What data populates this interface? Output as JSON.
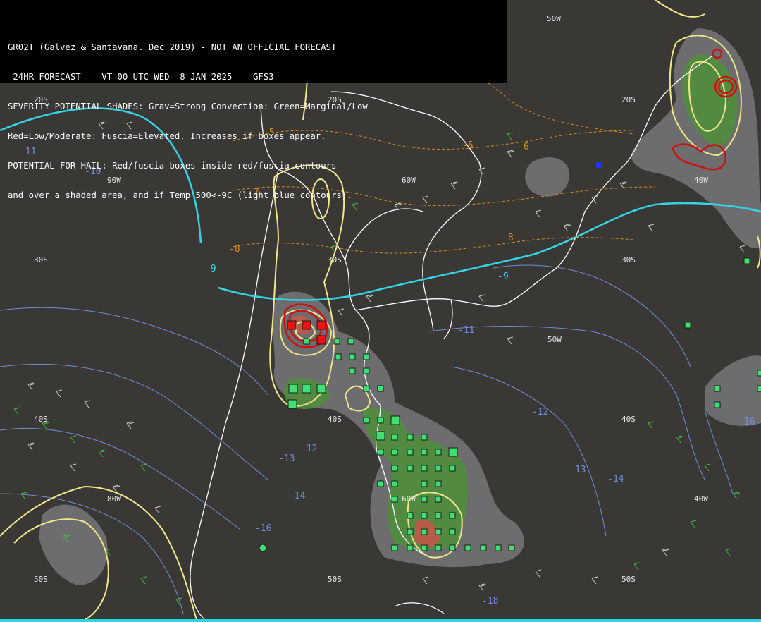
{
  "header": {
    "line1": "GR02T (Galvez & Santavana. Dec 2019) - NOT AN OFFICIAL FORECAST",
    "line2": " 24HR FORECAST    VT 00 UTC WED  8 JAN 2025    GFS3",
    "line3": "SEVERITY POTENTIAL SHADES: Grav=Strong Convection: Green=Marginal/Low",
    "line4": "Red=Low/Moderate: Fuscia=Elevated. Increases if boxes appear.",
    "line5": "POTENTIAL FOR HAIL: Red/fuscia boxes inside red/fuscia contours",
    "line6": "and over a shaded area, and if Temp 500<-9C (light blue contours)."
  },
  "grid_labels": {
    "lat_20s_a": "20S",
    "lat_20s_b": "20S",
    "lat_20s_c": "20S",
    "lat_30s_a": "30S",
    "lat_30s_b": "30S",
    "lat_30s_c": "30S",
    "lat_40s_a": "40S",
    "lat_40s_b": "40S",
    "lat_40s_c": "40S",
    "lat_50s_a": "50S",
    "lat_50s_b": "50S",
    "lat_50s_c": "50S",
    "lon_50w_top": "50W",
    "lon_90w": "90W",
    "lon_60w": "60W",
    "lon_40w": "40W",
    "lon_50w_mid": "50W",
    "lon_80w": "80W",
    "lon_60w_low": "60W",
    "lon_40w_low": "40W"
  },
  "contour_labels": {
    "o5": "-5",
    "o5b": "-5",
    "o6": "-6",
    "o7": "-7",
    "o8": "-8",
    "o8b": "-8",
    "c9a": "-9",
    "c9b": "-9",
    "b10": "-10",
    "b11": "-11",
    "b11b": "-11",
    "b12": "-12",
    "b12b": "-12",
    "b13": "-13",
    "b13b": "-13",
    "b14": "-14",
    "b14b": "-14",
    "b16": "-16",
    "b16b": "-16",
    "b18": "-18"
  },
  "colors": {
    "background": "#3a3835",
    "coastline": "#ffffff",
    "severity_gray": "#7f7f84",
    "severity_green": "#4f8f3a",
    "severity_red": "#c0584a",
    "hail_box_green": "#3fe070",
    "hail_box_red": "#ee1111",
    "temp_500_contour": "#33d6e6",
    "isoline_blue": "#6f8fd8",
    "isoline_orange": "#d98a1c",
    "yellow_contour": "#f0e68a",
    "wind_barb_white": "#cfcfcf",
    "wind_barb_green": "#3fc040"
  }
}
